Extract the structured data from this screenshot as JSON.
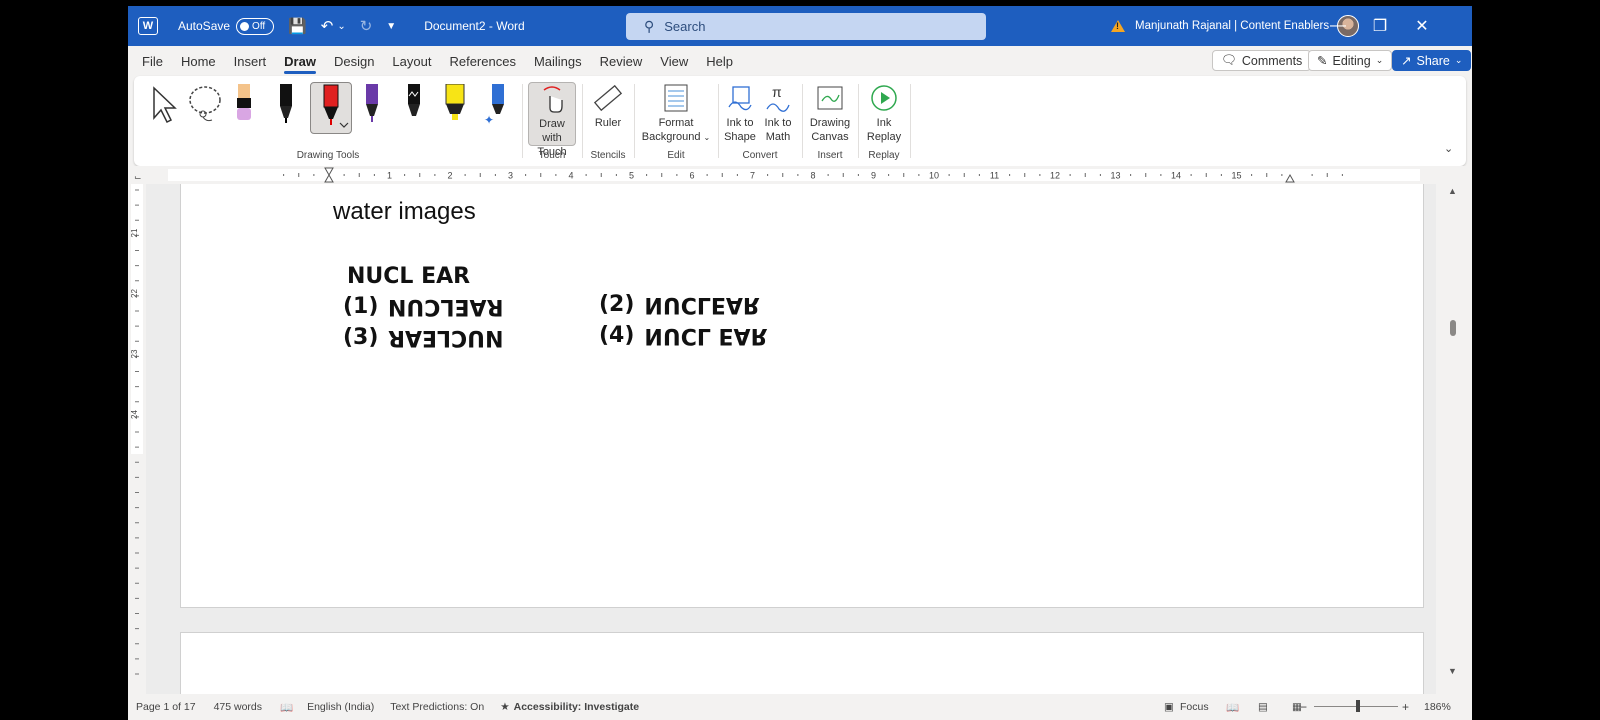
{
  "titlebar": {
    "autosave_label": "AutoSave",
    "autosave_state": "Off",
    "document_title": "Document2  -  Word",
    "search_placeholder": "Search",
    "user": "Manjunath Rajanal | Content Enablers",
    "accent_color": "#1e5ebf"
  },
  "tabs": [
    "File",
    "Home",
    "Insert",
    "Draw",
    "Design",
    "Layout",
    "References",
    "Mailings",
    "Review",
    "View",
    "Help"
  ],
  "active_tab": "Draw",
  "tab_actions": {
    "comments": "Comments",
    "editing": "Editing",
    "share": "Share"
  },
  "ribbon": {
    "groups": {
      "drawing_tools": "Drawing Tools",
      "touch": "Touch",
      "stencils": "Stencils",
      "edit": "Edit",
      "convert": "Convert",
      "insert": "Insert",
      "replay": "Replay"
    },
    "buttons": {
      "draw_with_touch": [
        "Draw with",
        "Touch"
      ],
      "ruler": "Ruler",
      "format_background": [
        "Format",
        "Background"
      ],
      "ink_to_shape": [
        "Ink to",
        "Shape"
      ],
      "ink_to_math": [
        "Ink to",
        "Math"
      ],
      "drawing_canvas": [
        "Drawing",
        "Canvas"
      ],
      "ink_replay": [
        "Ink",
        "Replay"
      ]
    },
    "pens": [
      "select-arrow",
      "lasso",
      "pencil-purple",
      "pen-black",
      "pen-red",
      "pen-purple",
      "pen-black-galaxy",
      "highlighter-yellow",
      "pen-blue-sparkle"
    ]
  },
  "ruler_numbers": [
    "1",
    "2",
    "3",
    "4",
    "5",
    "6",
    "7",
    "8",
    "9",
    "10",
    "11",
    "12",
    "13",
    "14",
    "15"
  ],
  "vruler_numbers": [
    "21",
    "22",
    "23",
    "24"
  ],
  "document": {
    "heading": "water images",
    "question_word": "NUCL EAR",
    "options": [
      {
        "num": "(1)",
        "text": "RAELCUN"
      },
      {
        "num": "(2)",
        "text": "NUCLEAR"
      },
      {
        "num": "(3)",
        "text": "NUCLEAR"
      },
      {
        "num": "(4)",
        "text": "NUCL EAR"
      }
    ]
  },
  "statusbar": {
    "page": "Page 1 of 17",
    "words": "475 words",
    "language": "English (India)",
    "text_predictions": "Text Predictions: On",
    "accessibility": "Accessibility: Investigate",
    "focus": "Focus",
    "zoom": "186%"
  }
}
